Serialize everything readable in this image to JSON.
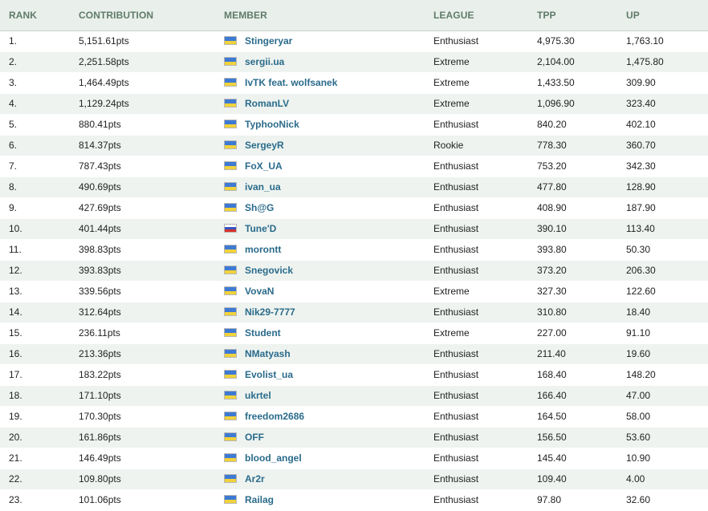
{
  "columns": {
    "rank": "RANK",
    "contribution": "CONTRIBUTION",
    "member": "MEMBER",
    "league": "LEAGUE",
    "tpp": "TPP",
    "up": "UP"
  },
  "colors": {
    "header_bg": "#e9efea",
    "header_text": "#5f7b6a",
    "alt_row_bg": "#eef3ef",
    "member_link": "#2a6b8b"
  },
  "rows": [
    {
      "rank": "1.",
      "contribution": "5,151.61pts",
      "flag": "ua",
      "member": "Stingeryar",
      "league": "Enthusiast",
      "tpp": "4,975.30",
      "up": "1,763.10"
    },
    {
      "rank": "2.",
      "contribution": "2,251.58pts",
      "flag": "ua",
      "member": "sergii.ua",
      "league": "Extreme",
      "tpp": "2,104.00",
      "up": "1,475.80"
    },
    {
      "rank": "3.",
      "contribution": "1,464.49pts",
      "flag": "ua",
      "member": "IvTK feat. wolfsanek",
      "league": "Extreme",
      "tpp": "1,433.50",
      "up": "309.90"
    },
    {
      "rank": "4.",
      "contribution": "1,129.24pts",
      "flag": "ua",
      "member": "RomanLV",
      "league": "Extreme",
      "tpp": "1,096.90",
      "up": "323.40"
    },
    {
      "rank": "5.",
      "contribution": "880.41pts",
      "flag": "ua",
      "member": "TyphooNick",
      "league": "Enthusiast",
      "tpp": "840.20",
      "up": "402.10"
    },
    {
      "rank": "6.",
      "contribution": "814.37pts",
      "flag": "ua",
      "member": "SergeyR",
      "league": "Rookie",
      "tpp": "778.30",
      "up": "360.70"
    },
    {
      "rank": "7.",
      "contribution": "787.43pts",
      "flag": "ua",
      "member": "FoX_UA",
      "league": "Enthusiast",
      "tpp": "753.20",
      "up": "342.30"
    },
    {
      "rank": "8.",
      "contribution": "490.69pts",
      "flag": "ua",
      "member": "ivan_ua",
      "league": "Enthusiast",
      "tpp": "477.80",
      "up": "128.90"
    },
    {
      "rank": "9.",
      "contribution": "427.69pts",
      "flag": "ua",
      "member": "Sh@G",
      "league": "Enthusiast",
      "tpp": "408.90",
      "up": "187.90"
    },
    {
      "rank": "10.",
      "contribution": "401.44pts",
      "flag": "ru",
      "member": "Tune'D",
      "league": "Enthusiast",
      "tpp": "390.10",
      "up": "113.40"
    },
    {
      "rank": "11.",
      "contribution": "398.83pts",
      "flag": "ua",
      "member": "morontt",
      "league": "Enthusiast",
      "tpp": "393.80",
      "up": "50.30"
    },
    {
      "rank": "12.",
      "contribution": "393.83pts",
      "flag": "ua",
      "member": "Snegovick",
      "league": "Enthusiast",
      "tpp": "373.20",
      "up": "206.30"
    },
    {
      "rank": "13.",
      "contribution": "339.56pts",
      "flag": "ua",
      "member": "VovaN",
      "league": "Extreme",
      "tpp": "327.30",
      "up": "122.60"
    },
    {
      "rank": "14.",
      "contribution": "312.64pts",
      "flag": "ua",
      "member": "Nik29-7777",
      "league": "Enthusiast",
      "tpp": "310.80",
      "up": "18.40"
    },
    {
      "rank": "15.",
      "contribution": "236.11pts",
      "flag": "ua",
      "member": "Student",
      "league": "Extreme",
      "tpp": "227.00",
      "up": "91.10"
    },
    {
      "rank": "16.",
      "contribution": "213.36pts",
      "flag": "ua",
      "member": "NMatyash",
      "league": "Enthusiast",
      "tpp": "211.40",
      "up": "19.60"
    },
    {
      "rank": "17.",
      "contribution": "183.22pts",
      "flag": "ua",
      "member": "Evolist_ua",
      "league": "Enthusiast",
      "tpp": "168.40",
      "up": "148.20"
    },
    {
      "rank": "18.",
      "contribution": "171.10pts",
      "flag": "ua",
      "member": "ukrtel",
      "league": "Enthusiast",
      "tpp": "166.40",
      "up": "47.00"
    },
    {
      "rank": "19.",
      "contribution": "170.30pts",
      "flag": "ua",
      "member": "freedom2686",
      "league": "Enthusiast",
      "tpp": "164.50",
      "up": "58.00"
    },
    {
      "rank": "20.",
      "contribution": "161.86pts",
      "flag": "ua",
      "member": "OFF",
      "league": "Enthusiast",
      "tpp": "156.50",
      "up": "53.60"
    },
    {
      "rank": "21.",
      "contribution": "146.49pts",
      "flag": "ua",
      "member": "blood_angel",
      "league": "Enthusiast",
      "tpp": "145.40",
      "up": "10.90"
    },
    {
      "rank": "22.",
      "contribution": "109.80pts",
      "flag": "ua",
      "member": "Ar2r",
      "league": "Enthusiast",
      "tpp": "109.40",
      "up": "4.00"
    },
    {
      "rank": "23.",
      "contribution": "101.06pts",
      "flag": "ua",
      "member": "Railag",
      "league": "Enthusiast",
      "tpp": "97.80",
      "up": "32.60"
    }
  ]
}
